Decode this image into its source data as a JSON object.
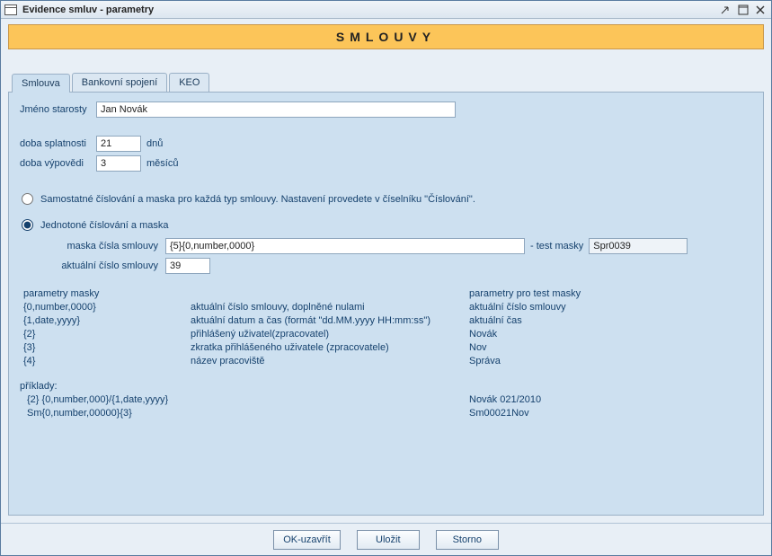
{
  "window": {
    "title": "Evidence smluv - parametry"
  },
  "banner": "SMLOUVY",
  "tabs": {
    "smlouva": "Smlouva",
    "bankovni": "Bankovní spojení",
    "keo": "KEO"
  },
  "fields": {
    "mayor_label": "Jméno starosty",
    "mayor_value": "Jan Novák",
    "due_label": "doba splatnosti",
    "due_value": "21",
    "due_unit": "dnů",
    "notice_label": "doba výpovědi",
    "notice_value": "3",
    "notice_unit": "měsíců"
  },
  "radios": {
    "separate": "Samostatné číslování a maska pro každá typ smlouvy. Nastavení provedete v číselníku \"Číslování\".",
    "unified": "Jednotoné číslování a maska"
  },
  "mask": {
    "mask_label": "maska čísla smlouvy",
    "mask_value": "{5}{0,number,0000}",
    "test_label": "- test masky",
    "test_value": "Spr0039",
    "current_label": "aktuální číslo smlouvy",
    "current_value": "39"
  },
  "params": {
    "hdr_left": "parametry masky",
    "hdr_right": "parametry pro test masky",
    "r1c1": "{0,number,0000}",
    "r1c2": "aktuální číslo smlouvy, doplněné nulami",
    "r1c3": "aktuální číslo smlouvy",
    "r2c1": "{1,date,yyyy}",
    "r2c2": "aktuální datum a čas (formát \"dd.MM.yyyy HH:mm:ss\")",
    "r2c3": "aktuální čas",
    "r3c1": "{2}",
    "r3c2": "přihlášený uživatel(zpracovatel)",
    "r3c3": "Novák",
    "r4c1": "{3}",
    "r4c2": "zkratka přihlášeného uživatele (zpracovatele)",
    "r4c3": "Nov",
    "r5c1": "{4}",
    "r5c2": "název pracoviště",
    "r5c3": "Správa"
  },
  "examples": {
    "hdr": "příklady:",
    "e1a": "{2} {0,number,000}/{1,date,yyyy}",
    "e1b": "Novák 021/2010",
    "e2a": "Sm{0,number,00000}{3}",
    "e2b": "Sm00021Nov"
  },
  "buttons": {
    "ok": "OK-uzavřít",
    "save": "Uložit",
    "cancel": "Storno"
  }
}
